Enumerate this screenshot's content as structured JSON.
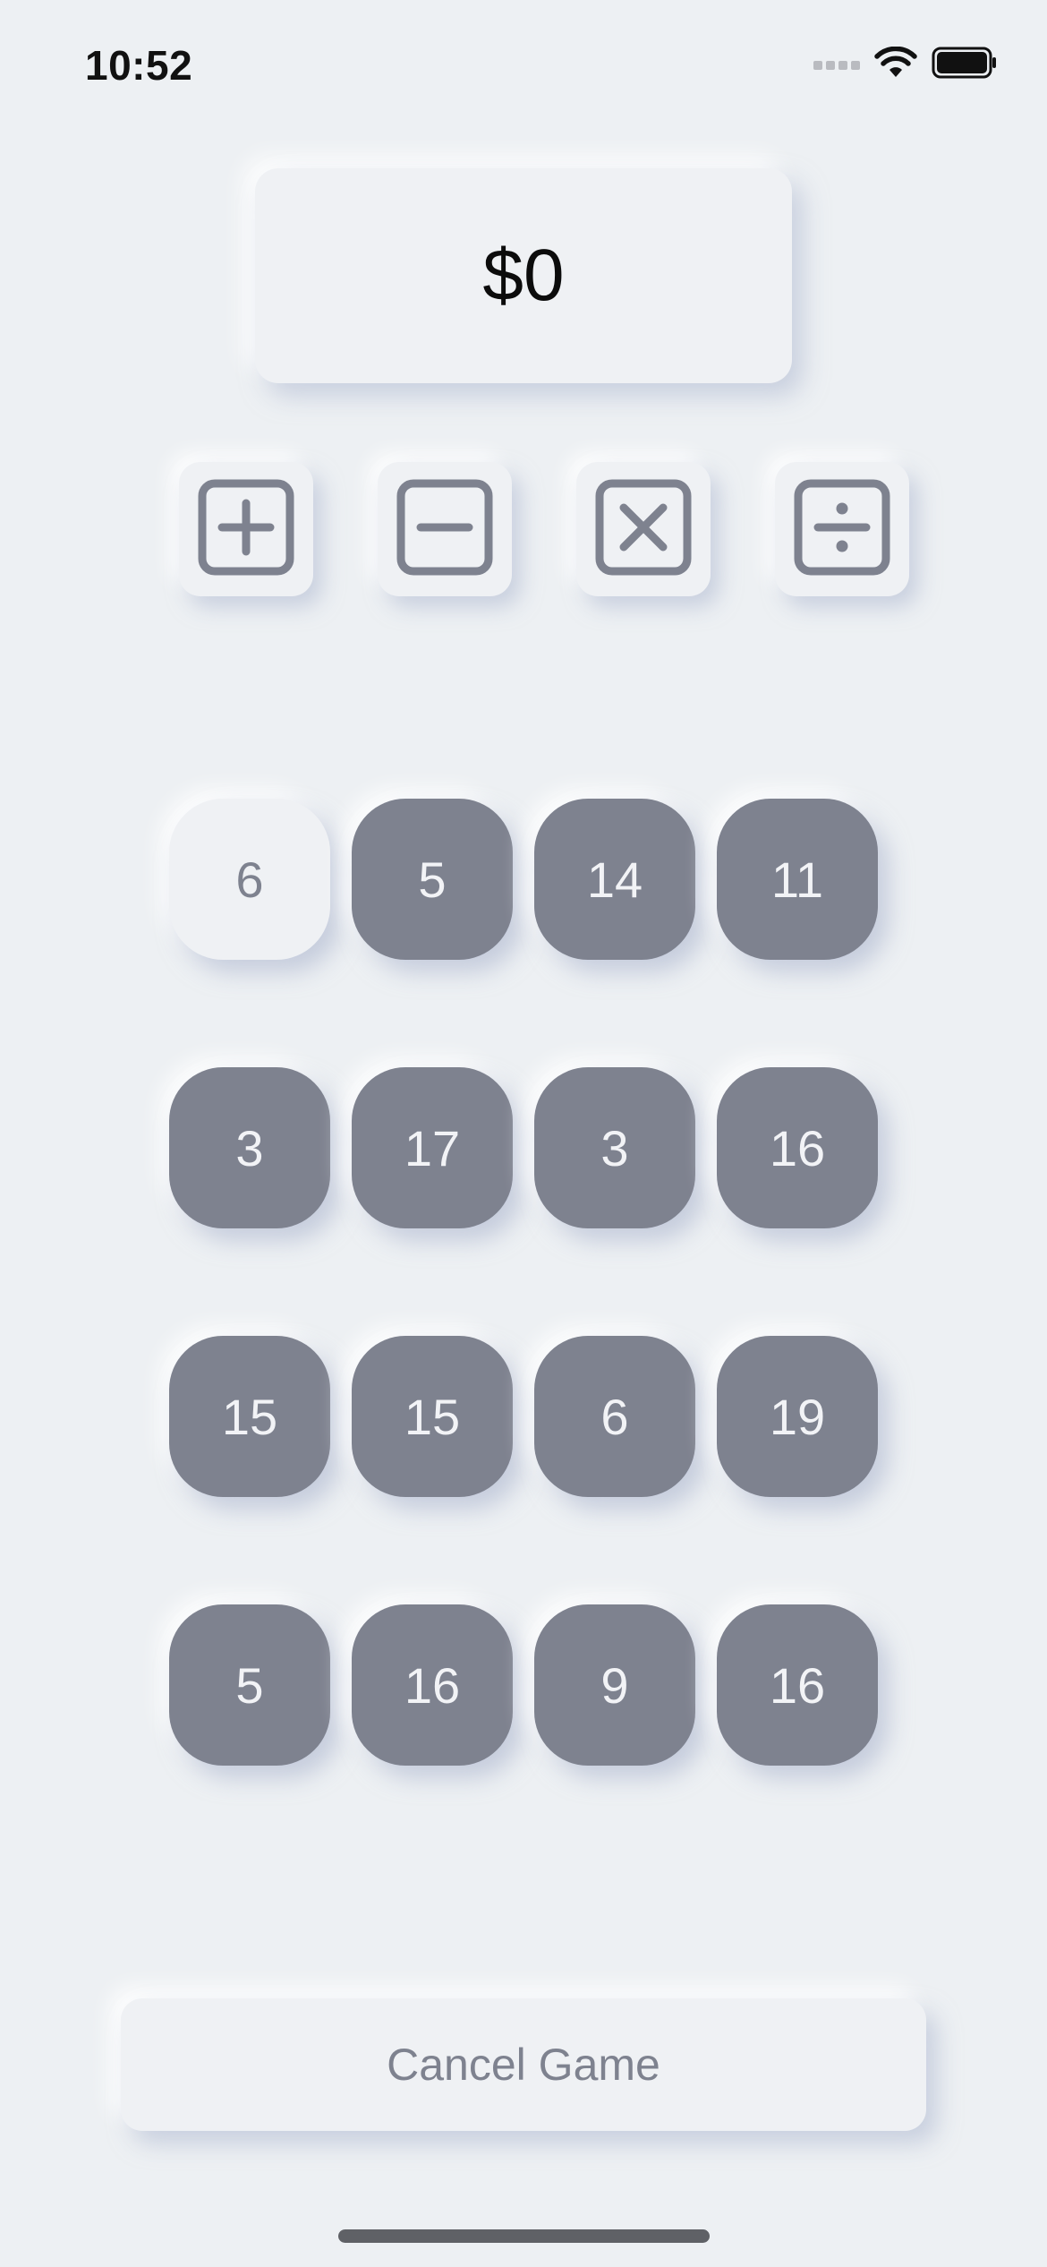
{
  "status_bar": {
    "time": "10:52",
    "icons": [
      "cellular-signal-icon",
      "wifi-icon",
      "battery-icon"
    ]
  },
  "score": {
    "value": "$0"
  },
  "operators": [
    {
      "name": "plus",
      "icon": "plus-square-icon"
    },
    {
      "name": "minus",
      "icon": "minus-square-icon"
    },
    {
      "name": "multiply",
      "icon": "multiply-square-icon"
    },
    {
      "name": "divide",
      "icon": "divide-square-icon"
    }
  ],
  "grid": {
    "rows": [
      [
        {
          "value": "6",
          "selected": true
        },
        {
          "value": "5",
          "selected": false
        },
        {
          "value": "14",
          "selected": false
        },
        {
          "value": "11",
          "selected": false
        }
      ],
      [
        {
          "value": "3",
          "selected": false
        },
        {
          "value": "17",
          "selected": false
        },
        {
          "value": "3",
          "selected": false
        },
        {
          "value": "16",
          "selected": false
        }
      ],
      [
        {
          "value": "15",
          "selected": false
        },
        {
          "value": "15",
          "selected": false
        },
        {
          "value": "6",
          "selected": false
        },
        {
          "value": "19",
          "selected": false
        }
      ],
      [
        {
          "value": "5",
          "selected": false
        },
        {
          "value": "16",
          "selected": false
        },
        {
          "value": "9",
          "selected": false
        },
        {
          "value": "16",
          "selected": false
        }
      ]
    ]
  },
  "actions": {
    "cancel_label": "Cancel Game"
  },
  "colors": {
    "background": "#edf0f3",
    "tile": "#7e828f",
    "tile_text": "#f2f3f6",
    "selected_tile": "#eff1f4",
    "icon_stroke": "#7e828f"
  }
}
